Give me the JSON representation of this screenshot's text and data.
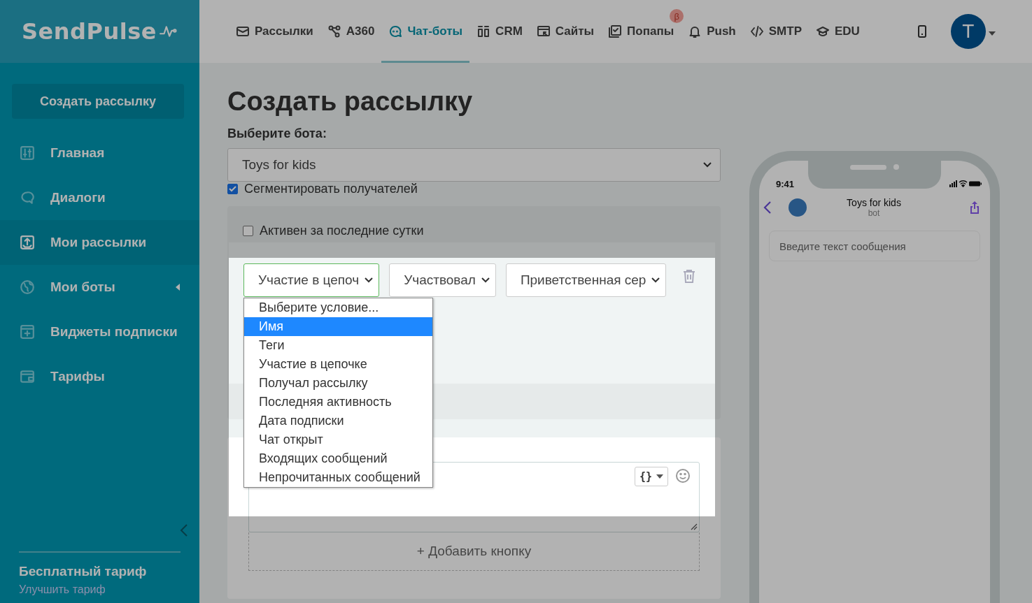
{
  "logo": "SendPulse",
  "top_nav": {
    "items": [
      {
        "label": "Рассылки",
        "selected": false
      },
      {
        "label": "A360",
        "selected": false
      },
      {
        "label": "Чат-боты",
        "selected": true
      },
      {
        "label": "CRM",
        "selected": false
      },
      {
        "label": "Сайты",
        "selected": false
      },
      {
        "label": "Попапы",
        "selected": false,
        "badge": "β"
      },
      {
        "label": "Push",
        "selected": false
      },
      {
        "label": "SMTP",
        "selected": false
      },
      {
        "label": "EDU",
        "selected": false
      }
    ],
    "avatar": "T"
  },
  "sidebar": {
    "create_button": "Создать рассылку",
    "items": [
      {
        "label": "Главная",
        "selected": false,
        "has_submenu": false
      },
      {
        "label": "Диалоги",
        "selected": false,
        "has_submenu": false
      },
      {
        "label": "Мои рассылки",
        "selected": true,
        "has_submenu": false
      },
      {
        "label": "Мои боты",
        "selected": false,
        "has_submenu": true
      },
      {
        "label": "Виджеты подписки",
        "selected": false,
        "has_submenu": false
      },
      {
        "label": "Тарифы",
        "selected": false,
        "has_submenu": false
      }
    ],
    "plan": {
      "name": "Бесплатный тариф",
      "link": "Улучшить тариф"
    }
  },
  "form": {
    "title": "Создать рассылку",
    "bot_label": "Выберите бота:",
    "bot_select": "Toys for kids",
    "segment_checkbox": {
      "label": "Сегментировать получателей",
      "checked": true
    },
    "active_checkbox": {
      "label": "Активен за последние сутки",
      "checked": false
    },
    "condition_selects": [
      {
        "value": "Участие в цепоч",
        "focused": true
      },
      {
        "value": "Участвовал",
        "focused": false
      },
      {
        "value": "Приветственная сер",
        "focused": false
      }
    ],
    "dropdown": {
      "options": [
        {
          "label": "Выберите условие...",
          "selected": false
        },
        {
          "label": "Имя",
          "selected": true
        },
        {
          "label": "Теги",
          "selected": false
        },
        {
          "label": "Участие в цепочке",
          "selected": false
        },
        {
          "label": "Получал рассылку",
          "selected": false
        },
        {
          "label": "Последняя активность",
          "selected": false
        },
        {
          "label": "Дата подписки",
          "selected": false
        },
        {
          "label": "Чат открыт",
          "selected": false
        },
        {
          "label": "Входящих сообщений",
          "selected": false
        },
        {
          "label": "Непрочитанных сообщений",
          "selected": false
        }
      ]
    },
    "variables_button": "{}",
    "add_button": "+ Добавить кнопку"
  },
  "phone": {
    "time": "9:41",
    "chat_title": "Toys for kids",
    "chat_subtitle": "bot",
    "input": {
      "placeholder": "Введите текст сообщения"
    }
  }
}
